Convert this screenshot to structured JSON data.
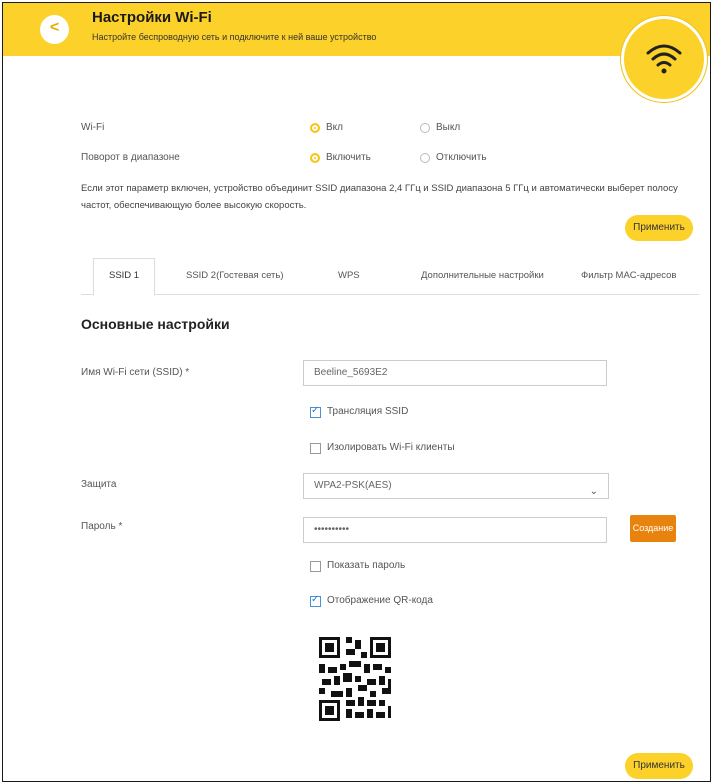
{
  "header": {
    "title": "Настройки Wi-Fi",
    "subtitle": "Настройте беспроводную сеть и подключите к ней ваше устройство"
  },
  "wifi": {
    "label": "Wi-Fi",
    "on_label": "Вкл",
    "off_label": "Выкл",
    "selected": "on"
  },
  "band_steering": {
    "label": "Поворот в диапазоне",
    "on_label": "Включить",
    "off_label": "Отключить",
    "selected": "on",
    "description": "Если этот параметр включен, устройство объединит SSID диапазона 2,4 ГГц и SSID диапазона 5 ГГц и автоматически выберет полосу частот, обеспечивающую более высокую скорость."
  },
  "apply_label": "Применить",
  "tabs": [
    {
      "label": "SSID 1"
    },
    {
      "label": "SSID 2(Гостевая сеть)"
    },
    {
      "label": "WPS"
    },
    {
      "label": "Дополнительные настройки"
    },
    {
      "label": "Фильтр MAC-адресов"
    }
  ],
  "basic": {
    "section_title": "Основные настройки",
    "ssid_label": "Имя Wi-Fi сети (SSID) *",
    "ssid_value": "Beeline_5693E2",
    "broadcast_label": "Трансляция SSID",
    "broadcast_checked": true,
    "isolate_label": "Изолировать Wi-Fi клиенты",
    "isolate_checked": false,
    "security_label": "Защита",
    "security_value": "WPA2-PSK(AES)",
    "password_label": "Пароль *",
    "password_value": "••••••••••",
    "generate_label": "Создание",
    "show_password_label": "Показать пароль",
    "show_password_checked": false,
    "qr_label": "Отображение QR-кода",
    "qr_checked": true
  },
  "colors": {
    "accent": "#fcd12a",
    "generate": "#e8830d"
  }
}
